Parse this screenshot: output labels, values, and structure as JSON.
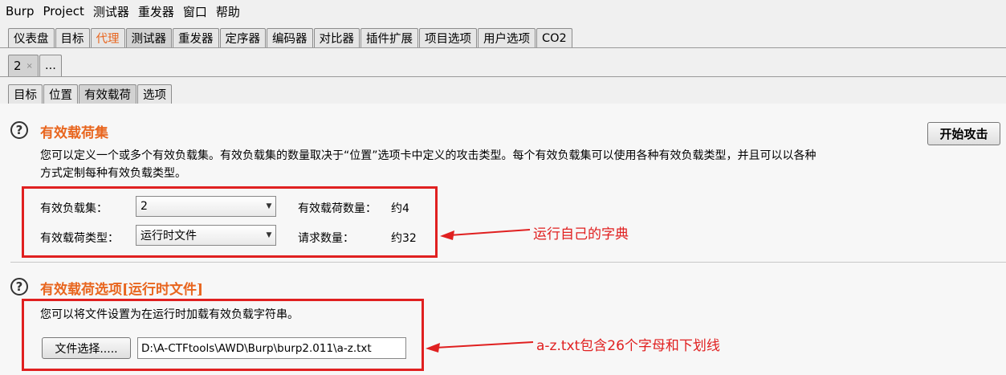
{
  "menubar": [
    "Burp",
    "Project",
    "测试器",
    "重发器",
    "窗口",
    "帮助"
  ],
  "main_tabs": [
    {
      "label": "仪表盘"
    },
    {
      "label": "目标"
    },
    {
      "label": "代理"
    },
    {
      "label": "测试器"
    },
    {
      "label": "重发器"
    },
    {
      "label": "定序器"
    },
    {
      "label": "编码器"
    },
    {
      "label": "对比器"
    },
    {
      "label": "插件扩展"
    },
    {
      "label": "项目选项"
    },
    {
      "label": "用户选项"
    },
    {
      "label": "CO2"
    }
  ],
  "attack_tabs": {
    "current": "2",
    "close": "×",
    "more": "..."
  },
  "sub_tabs": [
    {
      "label": "目标"
    },
    {
      "label": "位置"
    },
    {
      "label": "有效载荷"
    },
    {
      "label": "选项"
    }
  ],
  "payload_sets": {
    "help": "?",
    "title": "有效载荷集",
    "start_attack": "开始攻击",
    "description_line1": "您可以定义一个或多个有效负载集。有效负载集的数量取决于“位置”选项卡中定义的攻击类型。每个有效负载集可以使用各种有效负载类型，并且可以以各种",
    "description_line2": "方式定制每种有效负载类型。",
    "set_label": "有效负载集：",
    "set_value": "2",
    "count_label": "有效载荷数量：",
    "count_value": "约4",
    "type_label": "有效载荷类型：",
    "type_value": "运行时文件",
    "requests_label": "请求数量：",
    "requests_value": "约32",
    "annotation": "运行自己的字典"
  },
  "payload_options": {
    "help": "?",
    "title": "有效载荷选项[运行时文件]",
    "description": "您可以将文件设置为在运行时加载有效负载字符串。",
    "choose_file": "文件选择.....",
    "file_path": "D:\\A-CTFtools\\AWD\\Burp\\burp2.011\\a-z.txt",
    "annotation": "a-z.txt包含26个字母和下划线"
  },
  "colors": {
    "accent": "#e8651e",
    "annotation": "#e02020"
  }
}
